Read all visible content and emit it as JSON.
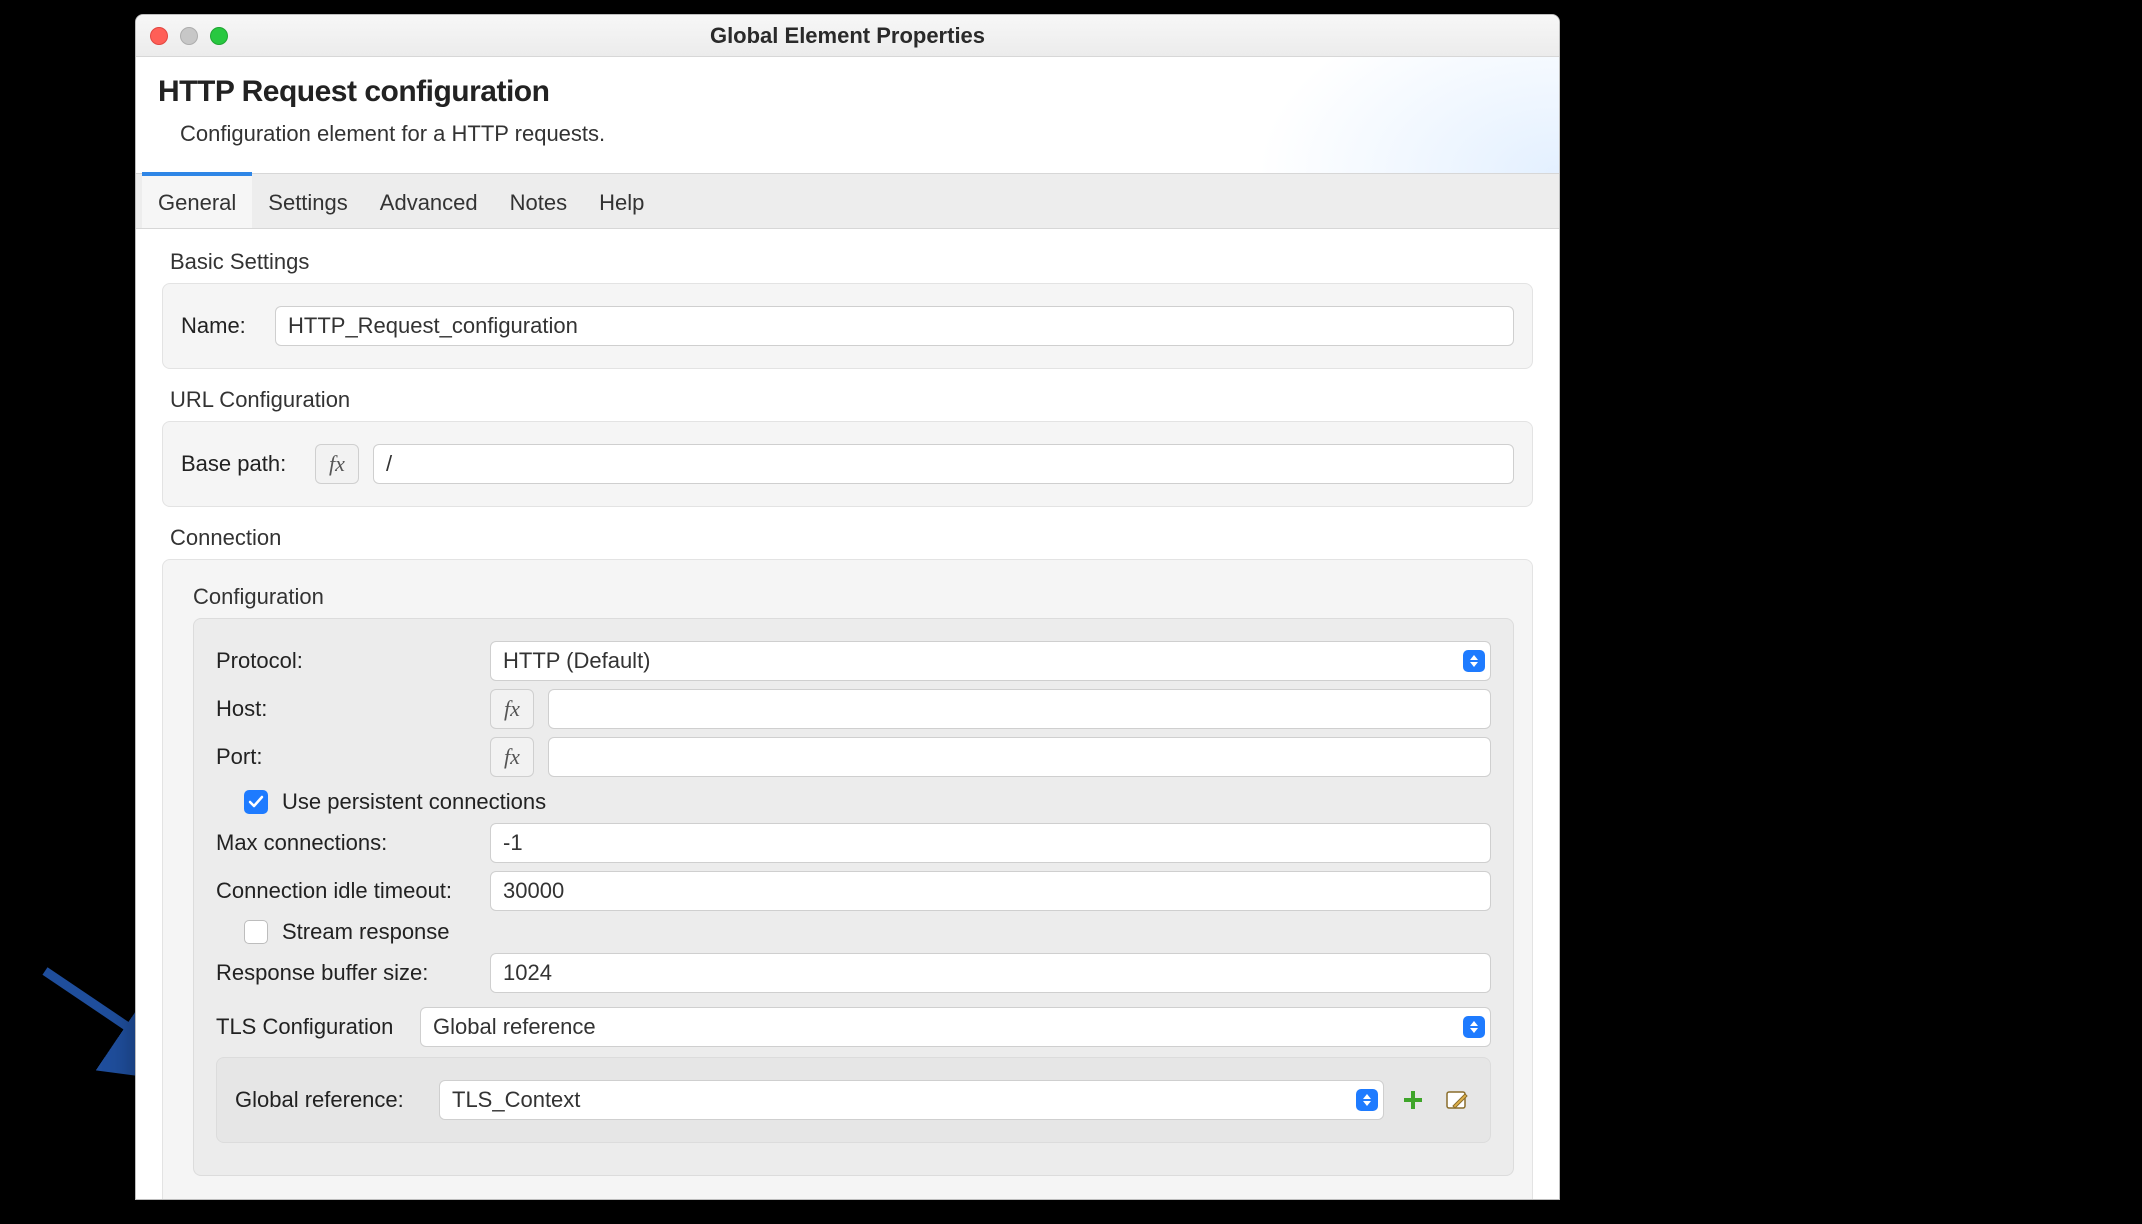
{
  "window": {
    "title": "Global Element Properties"
  },
  "header": {
    "title": "HTTP Request configuration",
    "subtitle": "Configuration element for a HTTP requests."
  },
  "tabs": [
    {
      "label": "General",
      "active": true
    },
    {
      "label": "Settings",
      "active": false
    },
    {
      "label": "Advanced",
      "active": false
    },
    {
      "label": "Notes",
      "active": false
    },
    {
      "label": "Help",
      "active": false
    }
  ],
  "basic": {
    "section_label": "Basic Settings",
    "name_label": "Name:",
    "name_value": "HTTP_Request_configuration"
  },
  "url": {
    "section_label": "URL Configuration",
    "basepath_label": "Base path:",
    "basepath_value": "/"
  },
  "connection": {
    "section_label": "Connection",
    "config_label": "Configuration",
    "protocol_label": "Protocol:",
    "protocol_value": "HTTP (Default)",
    "host_label": "Host:",
    "host_value": "",
    "port_label": "Port:",
    "port_value": "",
    "use_persistent_label": "Use persistent connections",
    "use_persistent_checked": true,
    "max_connections_label": "Max connections:",
    "max_connections_value": "-1",
    "idle_timeout_label": "Connection idle timeout:",
    "idle_timeout_value": "30000",
    "stream_response_label": "Stream response",
    "stream_response_checked": false,
    "response_buffer_label": "Response buffer size:",
    "response_buffer_value": "1024",
    "tls_label": "TLS Configuration",
    "tls_mode_value": "Global reference",
    "global_ref_label": "Global reference:",
    "global_ref_value": "TLS_Context"
  },
  "icons": {
    "fx": "fx"
  }
}
